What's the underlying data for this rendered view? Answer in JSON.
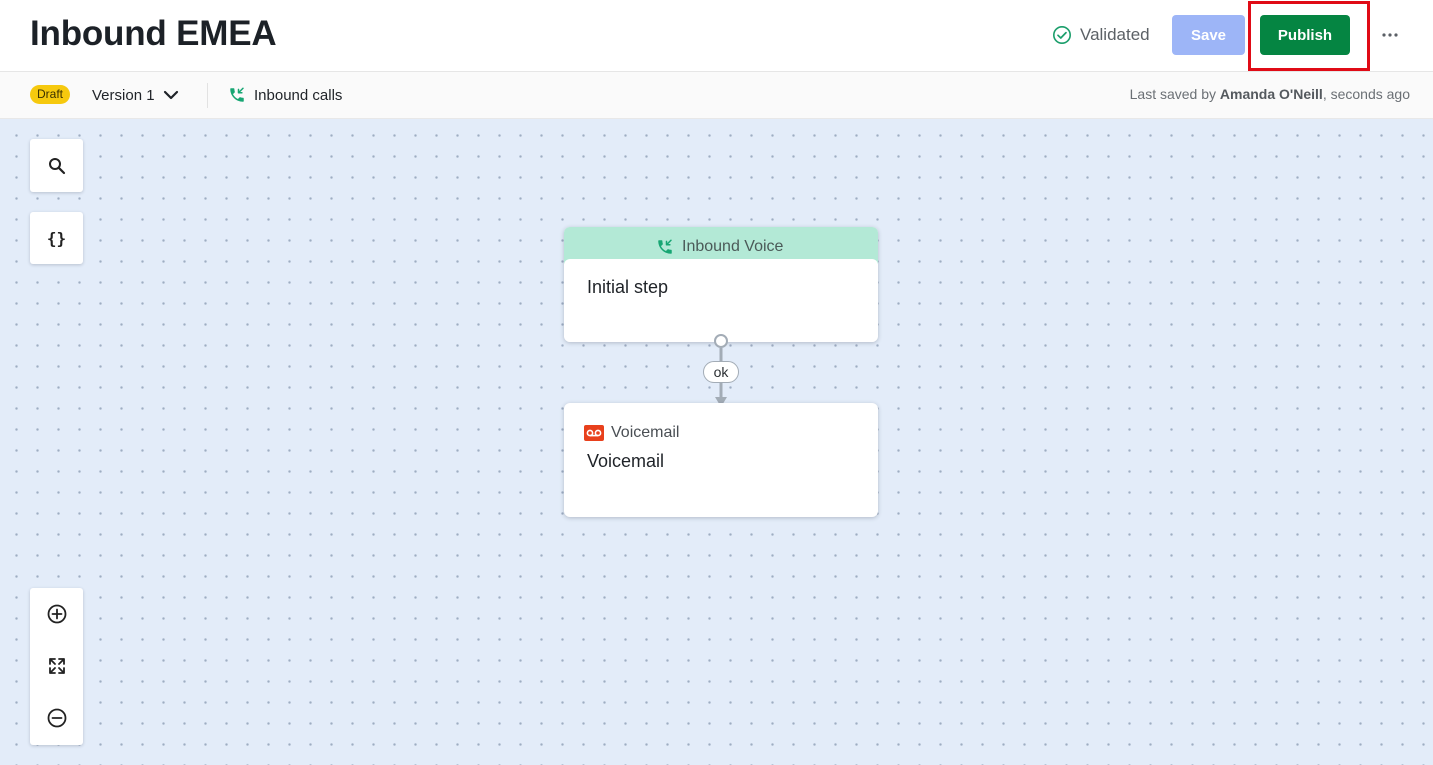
{
  "header": {
    "title": "Inbound EMEA",
    "status_label": "Validated",
    "save_label": "Save",
    "publish_label": "Publish"
  },
  "subbar": {
    "draft_label": "Draft",
    "version_label": "Version 1",
    "flow_type_label": "Inbound calls",
    "last_saved_prefix": "Last saved by",
    "last_saved_user": "Amanda O'Neill",
    "last_saved_suffix": ", seconds ago"
  },
  "canvas": {
    "variables_label": "{}",
    "nodes": [
      {
        "header": "Inbound Voice",
        "title": "Initial step"
      },
      {
        "type_label": "Voicemail",
        "title": "Voicemail"
      }
    ],
    "edges": [
      {
        "label": "ok"
      }
    ]
  },
  "icons": {
    "status": "check-circle-icon",
    "more": "more-horizontal-icon",
    "version_dropdown": "chevron-down-icon",
    "flow_type": "incoming-call-icon",
    "search": "search-icon",
    "zoom_in": "zoom-in-icon",
    "fit": "fit-screen-icon",
    "zoom_out": "zoom-out-icon",
    "voicemail": "voicemail-icon"
  },
  "colors": {
    "publish": "#058542",
    "save_disabled": "#9db5f7",
    "validated": "#1b9e6b",
    "draft_badge": "#f6c90e",
    "entry_header": "#b3e9d6",
    "voicemail_icon": "#e8401c",
    "canvas": "#e3ecf9",
    "highlight": "#e00b16"
  }
}
